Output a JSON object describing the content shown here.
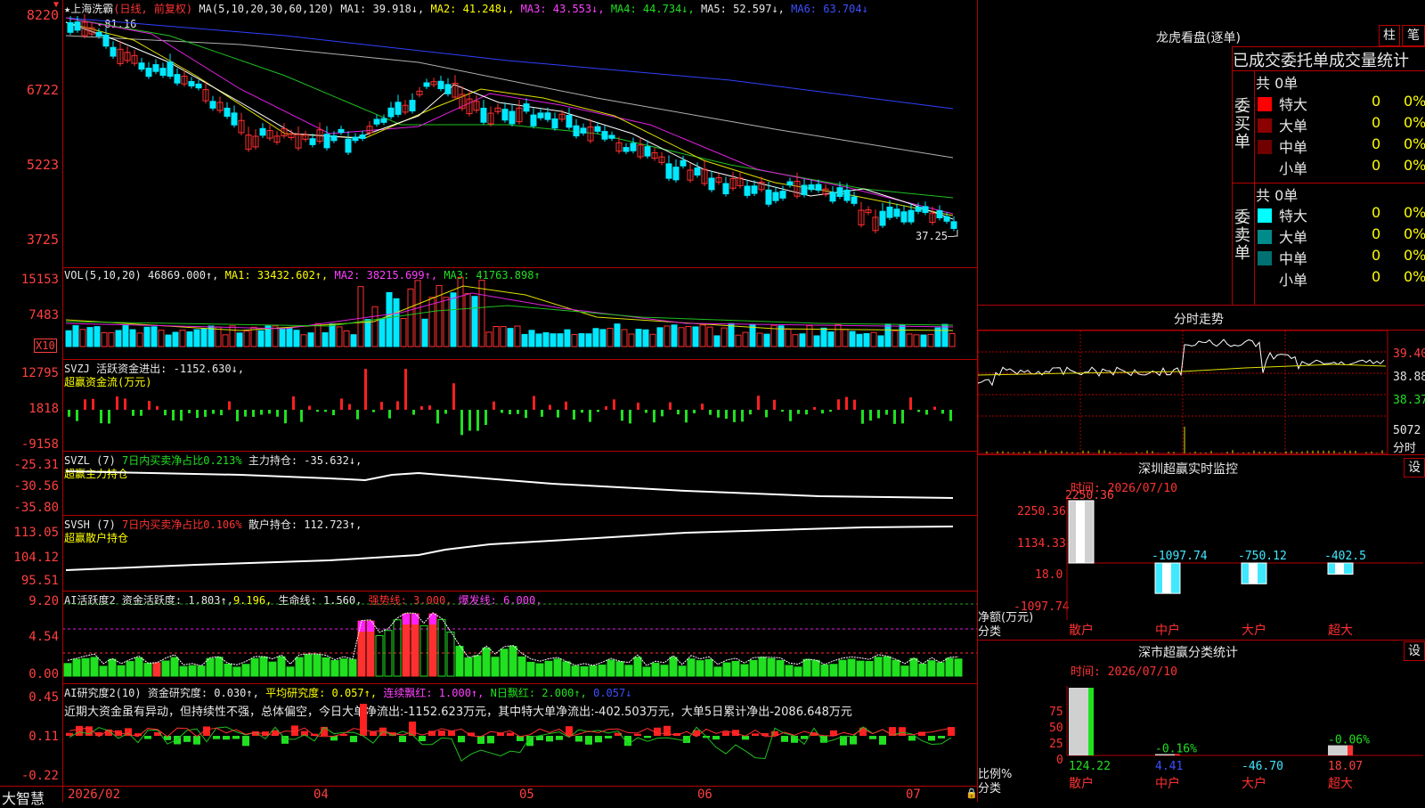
{
  "header": {
    "star": "★",
    "stock": "上海洗霸",
    "period": "(日线, 前复权)",
    "ma_text": "MA(5,10,20,30,60,120)",
    "ma1": "MA1: 39.918↓,",
    "ma2": "MA2: 41.248↓,",
    "ma3": "MA3: 43.553↓,",
    "ma4": "MA4: 44.734↓,",
    "ma5": "MA5: 52.597↓,",
    "ma6": "MA6: 63.704↓",
    "price_high_label": "81.16",
    "price_last_label": "37.25"
  },
  "price_axis": [
    "8220",
    "6722",
    "5223",
    "3725"
  ],
  "vol": {
    "title": "VOL(5,10,20)",
    "value": "46869.000↑,",
    "ma1": "MA1: 33432.602↑,",
    "ma2": "MA2: 38215.699↑,",
    "ma3": "MA3: 41763.898↑",
    "axis": [
      "15153",
      "7483"
    ],
    "unit": "X10"
  },
  "svzj": {
    "title": "SVZJ",
    "label": "活跃资金进出: -1152.630↓,",
    "sub": "超赢资金流(万元)",
    "axis": [
      "12795",
      "1818",
      "-9158"
    ]
  },
  "svzl": {
    "title": "SVZL (7)",
    "label": "7日内买卖净占比0.213%",
    "label2": "主力持仓: -35.632↓,",
    "sub": "超赢主力持仓",
    "axis": [
      "-25.31",
      "-30.56",
      "-35.80"
    ]
  },
  "svsh": {
    "title": "SVSH (7)",
    "label": "7日内买卖净占比0.106%",
    "label2": "散户持仓: 112.723↑,",
    "sub": "超赢散户持仓",
    "axis": [
      "113.05",
      "104.12",
      "95.51"
    ]
  },
  "ai1": {
    "title": "AI活跃度2",
    "label": "资金活跃度: 1.803↑,",
    "v2": "9.196,",
    "life": "生命线: 1.560,",
    "strong": "强势线: 3.000,",
    "burst": "爆发线: 6.000,",
    "axis": [
      "9.20",
      "4.54",
      "0.00"
    ]
  },
  "ai2": {
    "title": "AI研究度2(10)",
    "label": "资金研究度: 0.030↑,",
    "avg": "平均研究度: 0.057↑,",
    "cont": "连续飘红: 1.000↑,",
    "nday": "N日飘红: 2.000↑,",
    "last": "0.057↓",
    "comment": "近期大资金虽有异动，但持续性不强，总体偏空，今日大单净流出:-1152.623万元，其中特大单净流出:-402.503万元，大单5日累计净出-2086.648万元",
    "axis": [
      "0.45",
      "0.11",
      "-0.22"
    ]
  },
  "xaxis": {
    "brand": "大智慧",
    "labels": [
      "2026/02",
      "04",
      "05",
      "06",
      "07"
    ]
  },
  "right_panel": {
    "title": "龙虎看盘(逐单)",
    "btn_zhu": "柱",
    "btn_bi": "笔",
    "tabs": "已成交委托单成交量统计",
    "buy_group": "委买单",
    "sell_group": "委卖单",
    "total_buy": "共 0单",
    "total_sell": "共 0单",
    "buy_rows": [
      {
        "name": "特大",
        "count": "0",
        "pct": "0%",
        "color": "#ff0000"
      },
      {
        "name": "大单",
        "count": "0",
        "pct": "0%",
        "color": "#8b0000"
      },
      {
        "name": "中单",
        "count": "0",
        "pct": "0%",
        "color": "#700000"
      },
      {
        "name": "小单",
        "count": "0",
        "pct": "0%",
        "color": "#000000"
      }
    ],
    "sell_rows": [
      {
        "name": "特大",
        "count": "0",
        "pct": "0%",
        "color": "#00ffff"
      },
      {
        "name": "大单",
        "count": "0",
        "pct": "0%",
        "color": "#008b8b"
      },
      {
        "name": "中单",
        "count": "0",
        "pct": "0%",
        "color": "#007070"
      },
      {
        "name": "小单",
        "count": "0",
        "pct": "0%",
        "color": "#000000"
      }
    ],
    "intraday_title": "分时走势",
    "intraday_axis": [
      "39.40",
      "38.88",
      "38.37"
    ],
    "intraday_vol": "5072",
    "intraday_vol_label": "分时",
    "monitor_title": "深圳超赢实时监控",
    "monitor_time": "时间: 2026/07/10",
    "monitor_set": "设",
    "monitor_axis": [
      "2250.36",
      "1134.33",
      "18.0",
      "-1097.74"
    ],
    "monitor_ylabel": "净额(万元)",
    "monitor_xlabel": "分类",
    "monitor_values": [
      {
        "cat": "散户",
        "value": 2250.36,
        "label": "2250.36"
      },
      {
        "cat": "中户",
        "value": -1097.74,
        "label": "-1097.74"
      },
      {
        "cat": "大户",
        "value": -750.12,
        "label": "-750.12"
      },
      {
        "cat": "超大",
        "value": -402.5,
        "label": "-402.5"
      }
    ],
    "stat_title": "深市超赢分类统计",
    "stat_time": "时间: 2026/07/10",
    "stat_set": "设",
    "stat_axis": [
      "75",
      "50",
      "25",
      "0"
    ],
    "stat_ylabel": "比例%",
    "stat_xlabel": "分类",
    "stat_values": [
      {
        "cat": "散户",
        "pct": "",
        "value": "124.22",
        "bar": 100
      },
      {
        "cat": "中户",
        "pct": "-0.16%",
        "value": "4.41",
        "bar": 2
      },
      {
        "cat": "大户",
        "pct": "",
        "value": "-46.70",
        "bar": 0
      },
      {
        "cat": "超大",
        "pct": "-0.06%",
        "value": "18.07",
        "bar": 15
      }
    ]
  }
}
